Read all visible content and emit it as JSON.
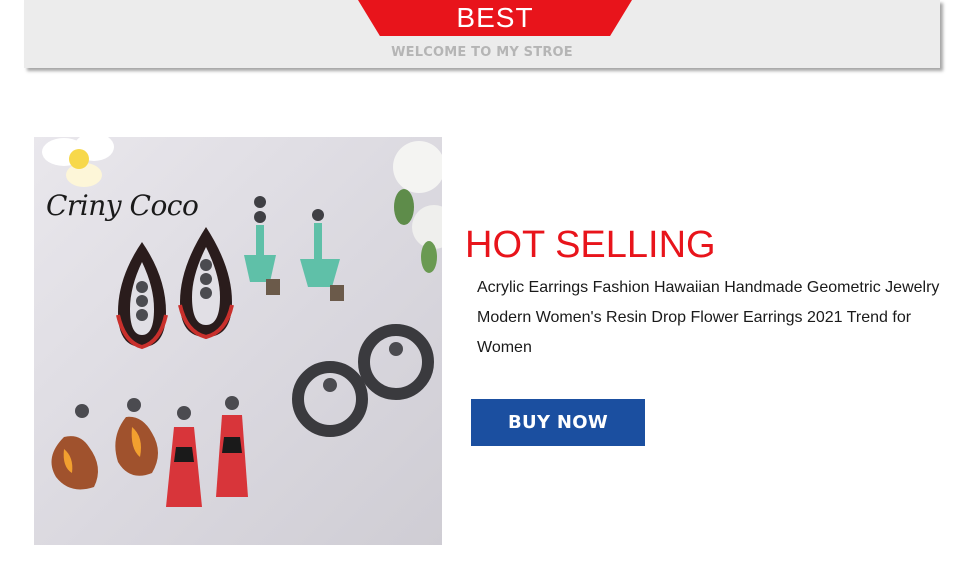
{
  "banner": {
    "title": "BEST",
    "subtitle": "WELCOME TO MY STROE"
  },
  "product": {
    "brand": "Criny Coco",
    "headline": "HOT SELLING",
    "description": "Acrylic Earrings Fashion Hawaiian Handmade Geometric Jewelry Modern Women's Resin Drop Flower Earrings 2021 Trend for Women",
    "buy_label": "BUY NOW"
  },
  "colors": {
    "accent_red": "#e8141b",
    "button_blue": "#1b4fa0"
  }
}
